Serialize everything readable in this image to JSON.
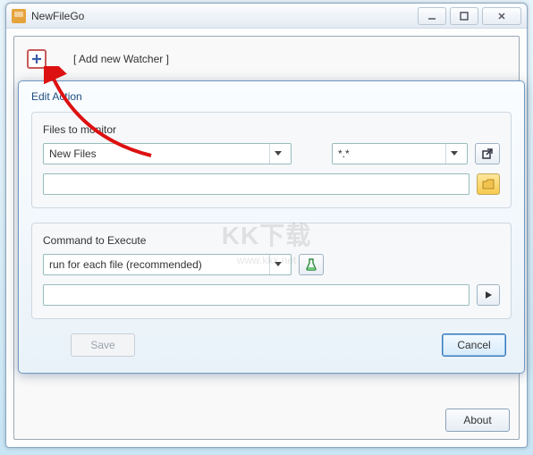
{
  "window": {
    "title": "NewFileGo"
  },
  "main": {
    "add_watcher_label": "[ Add new Watcher ]"
  },
  "dialog": {
    "title": "Edit Action",
    "files_group": {
      "label": "Files to monitor",
      "mode_combo": {
        "value": "New Files"
      },
      "pattern_combo": {
        "value": "*.*"
      }
    },
    "command_group": {
      "label": "Command to Execute",
      "run_mode_combo": {
        "value": "run for each file  (recommended)"
      }
    },
    "save_label": "Save",
    "cancel_label": "Cancel"
  },
  "footer": {
    "about_label": "About"
  },
  "watermark": {
    "line1": "KK下载",
    "line2": "www.kkx.net"
  }
}
